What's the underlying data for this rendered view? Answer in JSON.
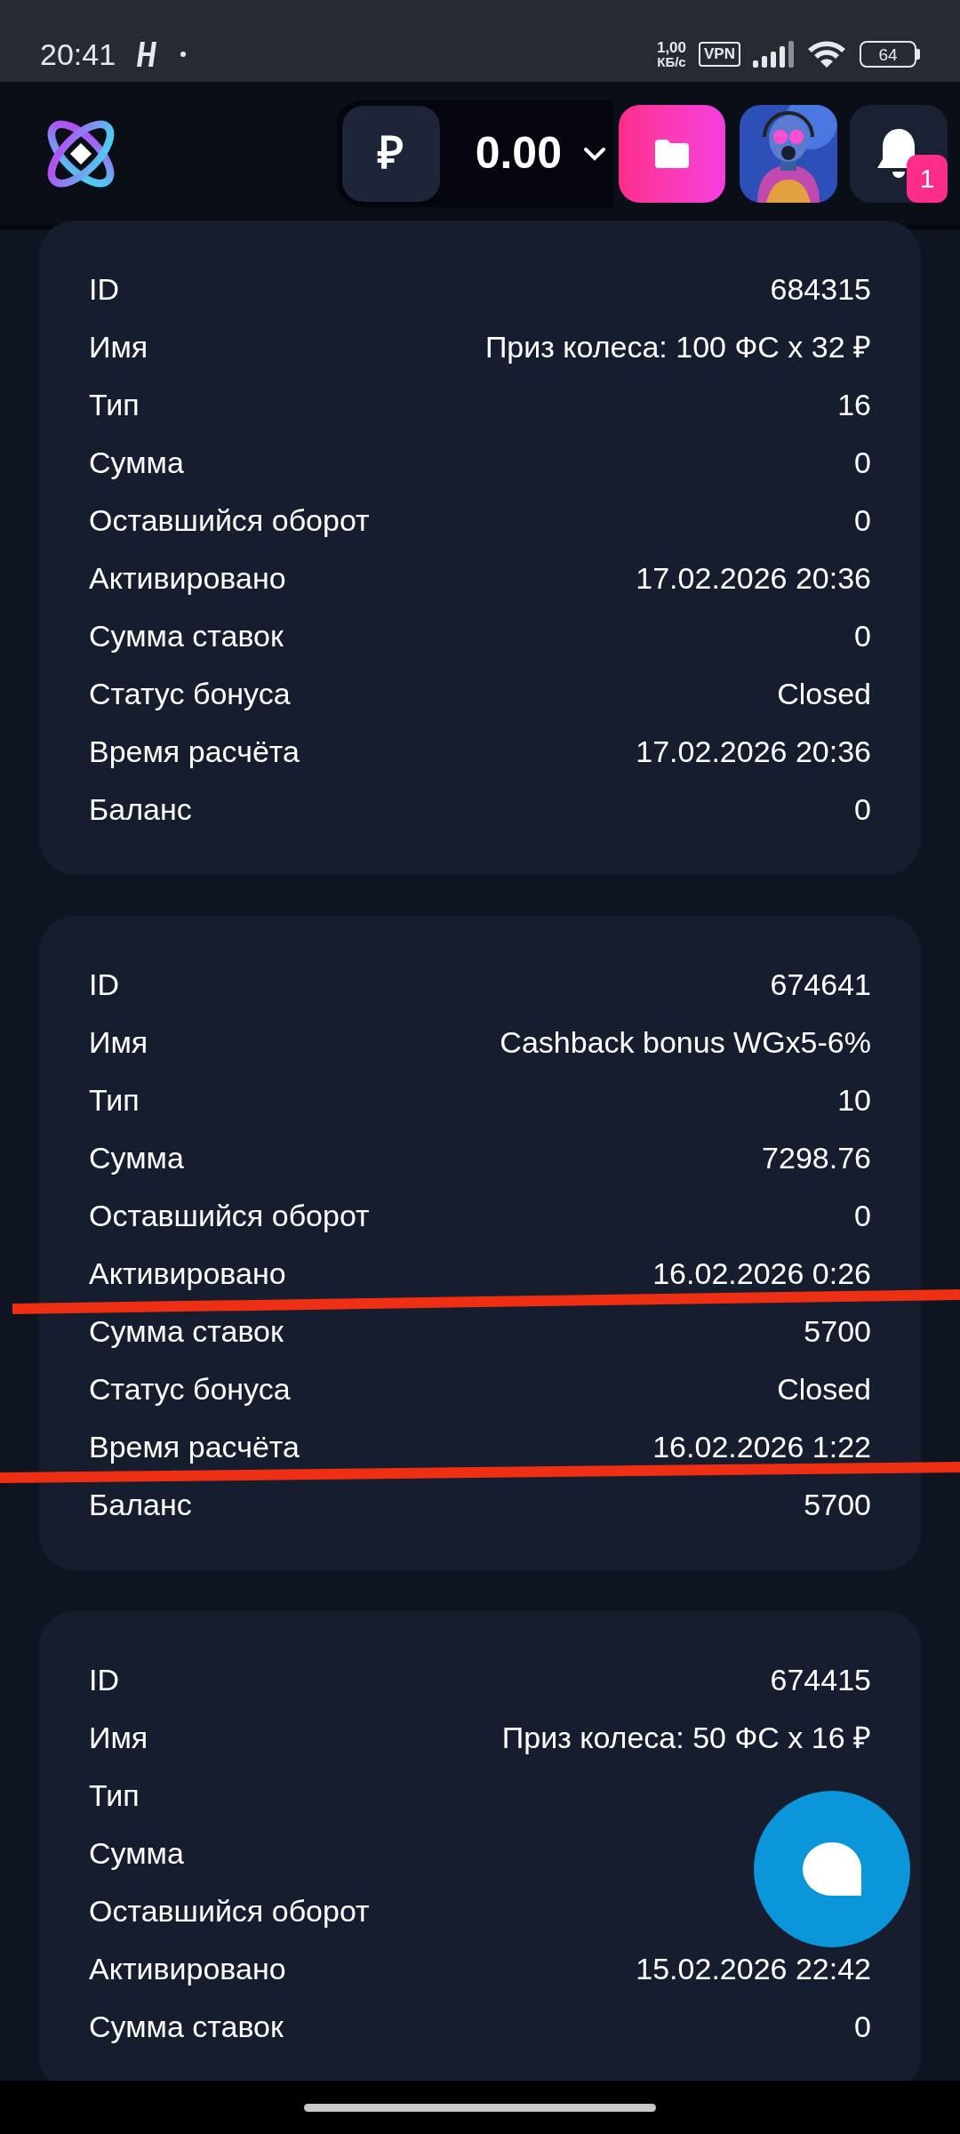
{
  "status_bar": {
    "time": "20:41",
    "speed_value": "1,00",
    "speed_unit": "КБ/с",
    "vpn": "VPN",
    "battery": "64"
  },
  "header": {
    "currency_symbol": "₽",
    "balance": "0.00",
    "notification_count": "1"
  },
  "cards": [
    {
      "rows": [
        {
          "label": "ID",
          "value": "684315"
        },
        {
          "label": "Имя",
          "value": "Приз колеса: 100 ФС x 32 ₽"
        },
        {
          "label": "Тип",
          "value": "16"
        },
        {
          "label": "Сумма",
          "value": "0"
        },
        {
          "label": "Оставшийся оборот",
          "value": "0"
        },
        {
          "label": "Активировано",
          "value": "17.02.2026 20:36"
        },
        {
          "label": "Сумма ставок",
          "value": "0"
        },
        {
          "label": "Статус бонуса",
          "value": "Closed"
        },
        {
          "label": "Время расчёта",
          "value": "17.02.2026 20:36"
        },
        {
          "label": "Баланс",
          "value": "0"
        }
      ]
    },
    {
      "rows": [
        {
          "label": "ID",
          "value": "674641"
        },
        {
          "label": "Имя",
          "value": "Cashback bonus WGx5-6%"
        },
        {
          "label": "Тип",
          "value": "10"
        },
        {
          "label": "Сумма",
          "value": "7298.76"
        },
        {
          "label": "Оставшийся оборот",
          "value": "0"
        },
        {
          "label": "Активировано",
          "value": "16.02.2026 0:26"
        },
        {
          "label": "Сумма ставок",
          "value": "5700"
        },
        {
          "label": "Статус бонуса",
          "value": "Closed"
        },
        {
          "label": "Время расчёта",
          "value": "16.02.2026 1:22"
        },
        {
          "label": "Баланс",
          "value": "5700"
        }
      ]
    },
    {
      "rows": [
        {
          "label": "ID",
          "value": "674415"
        },
        {
          "label": "Имя",
          "value": "Приз колеса: 50 ФС x 16 ₽"
        },
        {
          "label": "Тип"
        },
        {
          "label": "Сумма"
        },
        {
          "label": "Оставшийся оборот"
        },
        {
          "label": "Активировано",
          "value": "15.02.2026 22:42"
        },
        {
          "label": "Сумма ставок",
          "value": "0"
        }
      ]
    }
  ]
}
